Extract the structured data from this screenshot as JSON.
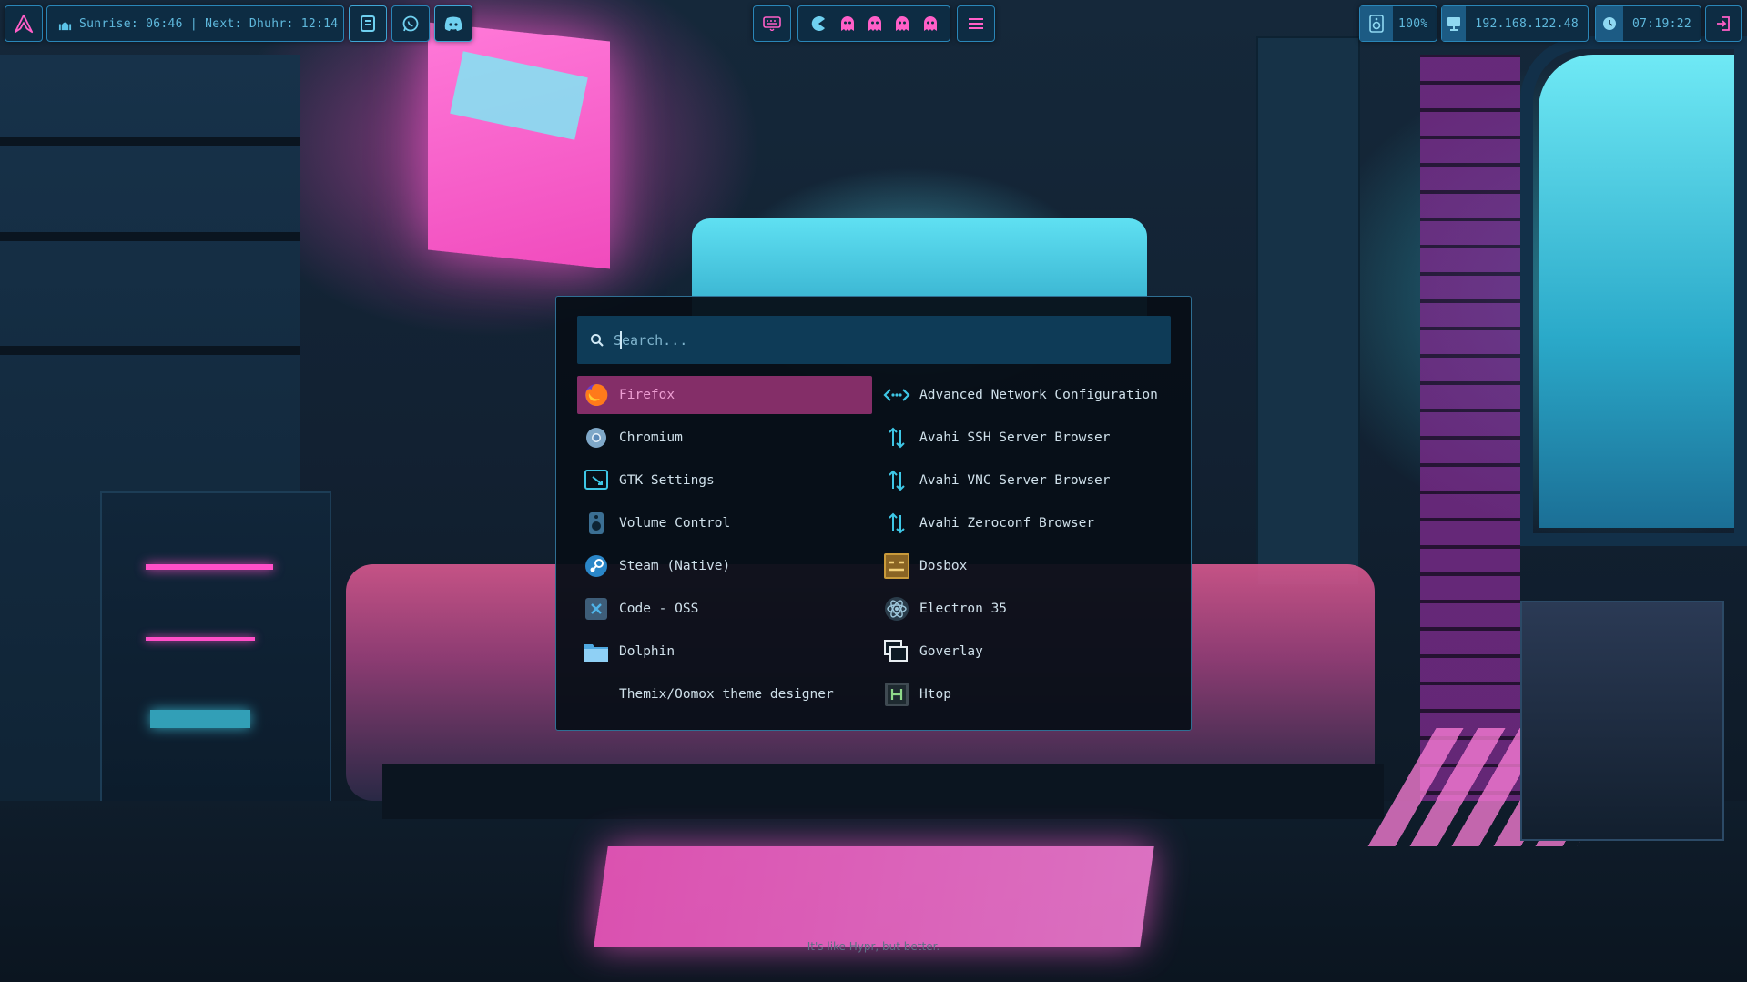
{
  "topbar": {
    "left": {
      "prayer_text": "Sunrise: 06:46 | Next: Dhuhr: 12:14"
    },
    "center": {
      "workspace_count": 5
    },
    "right": {
      "volume": "100%",
      "ip_address": "192.168.122.48",
      "clock": "07:19:22"
    }
  },
  "launcher": {
    "search_placeholder": "Search...",
    "left_column": [
      {
        "label": "Firefox",
        "icon": "firefox-icon",
        "selected": true
      },
      {
        "label": "Chromium",
        "icon": "chromium-icon"
      },
      {
        "label": "GTK Settings",
        "icon": "gtk-settings-icon"
      },
      {
        "label": "Volume Control",
        "icon": "speaker-icon"
      },
      {
        "label": "Steam (Native)",
        "icon": "steam-icon"
      },
      {
        "label": "Code - OSS",
        "icon": "vscode-icon"
      },
      {
        "label": "Dolphin",
        "icon": "folder-icon"
      },
      {
        "label": "Themix/Oomox theme designer",
        "icon": ""
      }
    ],
    "right_column": [
      {
        "label": "Advanced Network Configuration",
        "icon": "network-icon"
      },
      {
        "label": "Avahi SSH Server Browser",
        "icon": "transfer-arrows-icon"
      },
      {
        "label": "Avahi VNC Server Browser",
        "icon": "transfer-arrows-icon"
      },
      {
        "label": "Avahi Zeroconf Browser",
        "icon": "transfer-arrows-icon"
      },
      {
        "label": "Dosbox",
        "icon": "dosbox-icon"
      },
      {
        "label": "Electron 35",
        "icon": "electron-icon"
      },
      {
        "label": "Goverlay",
        "icon": "goverlay-icon"
      },
      {
        "label": "Htop",
        "icon": "htop-icon"
      }
    ]
  },
  "tagline": "It's like Hypr, but better.",
  "colors": {
    "bar_bg": "#0d2c43",
    "bar_border": "#2a86b8",
    "accent_cyan": "#5bc3e8",
    "selected_bg": "#842e68",
    "selected_text": "#ee9ed3"
  }
}
